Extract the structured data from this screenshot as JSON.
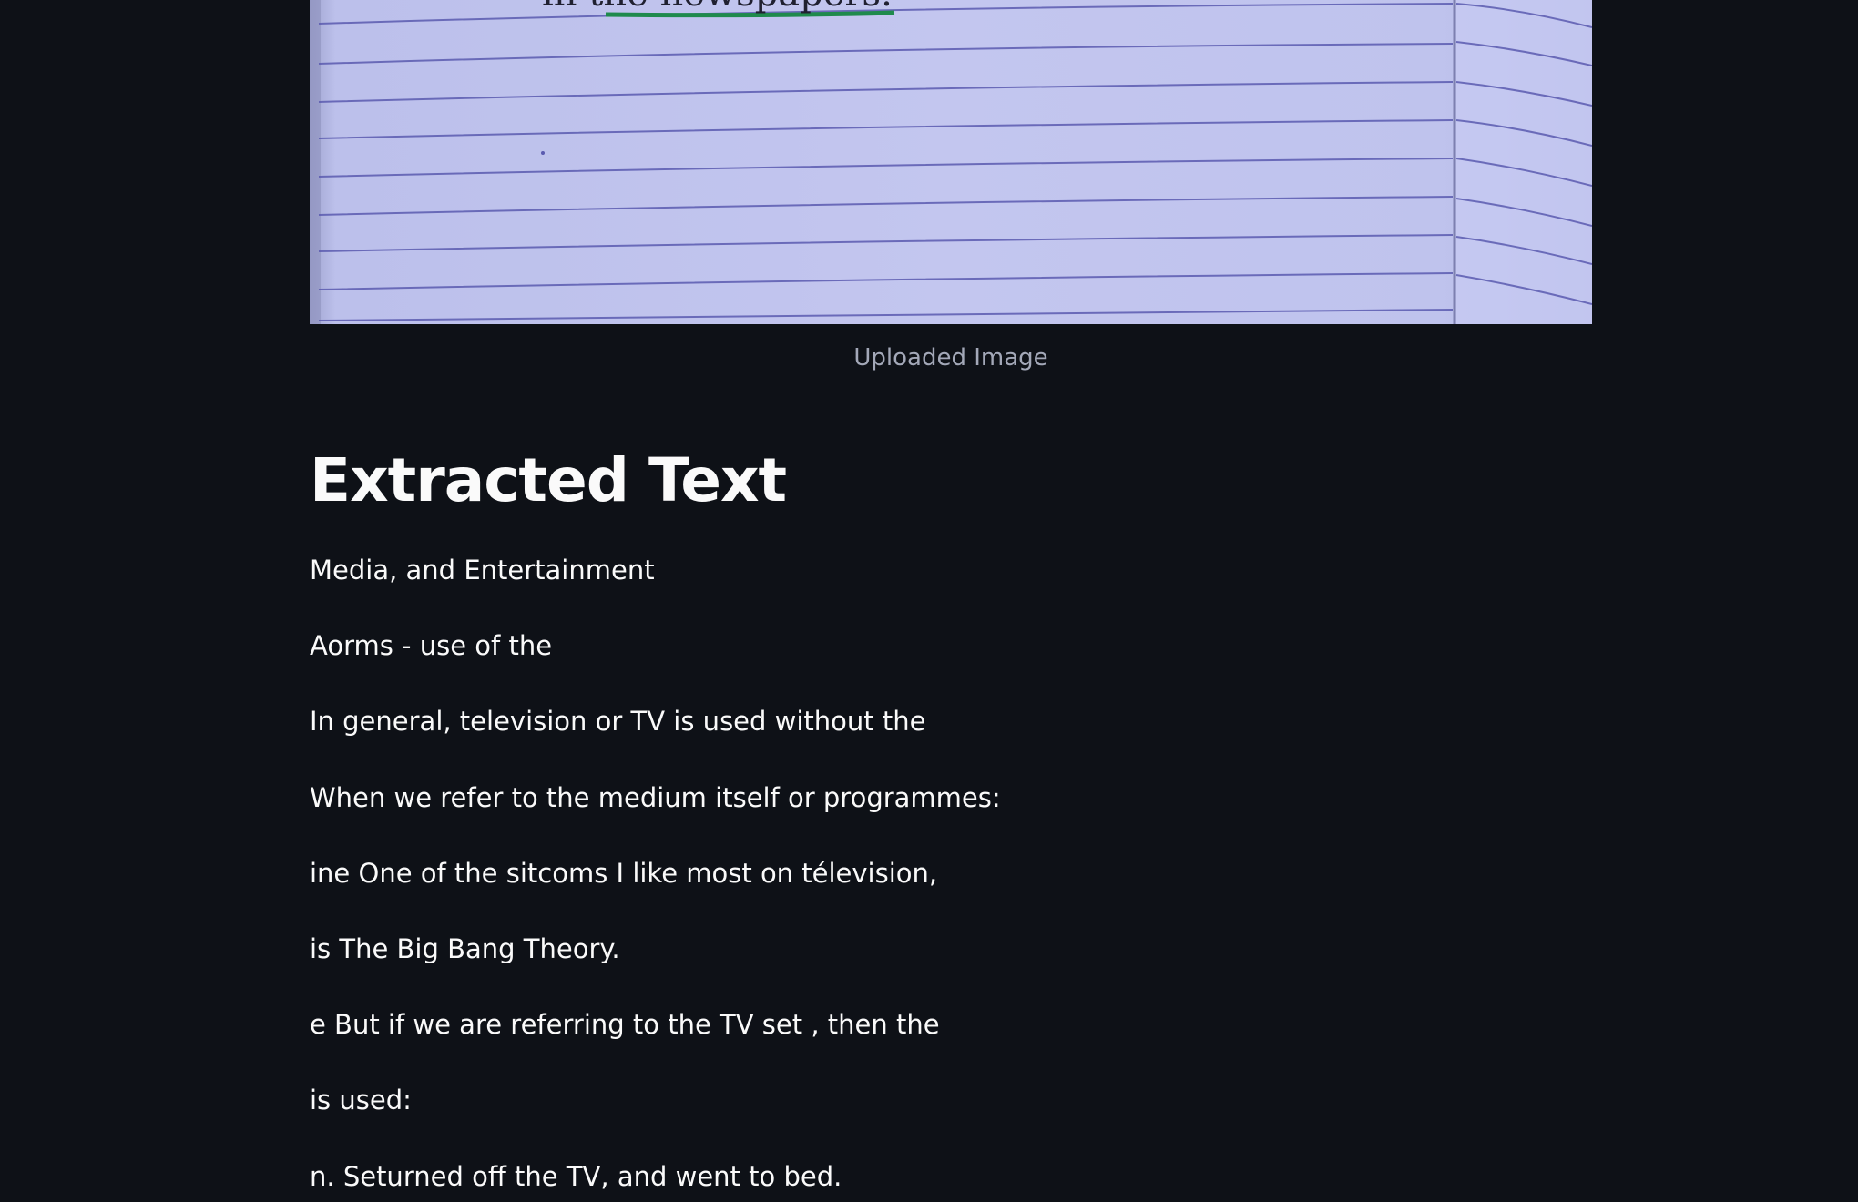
{
  "uploaded_image": {
    "caption": "Uploaded Image",
    "handwriting_fragment": "in the newspapers."
  },
  "extracted": {
    "heading": "Extracted Text",
    "lines": [
      "Media, and Entertainment",
      "Aorms - use of the",
      "In general, television or TV is used without the",
      "When we refer to the medium itself or programmes:",
      "ine One of the sitcoms I like most on télevision,",
      "is The Big Bang Theory.",
      "e But if we are referring to the TV set , then the",
      "is used:",
      "n. Seturned off the TV, and went to bed."
    ]
  },
  "colors": {
    "background": "#0e1117",
    "text": "#fafafa",
    "caption": "#a3a8b8",
    "paper": "#c3c6ef",
    "ruling": "#5b5bb0",
    "underline": "#1f8a4c"
  }
}
